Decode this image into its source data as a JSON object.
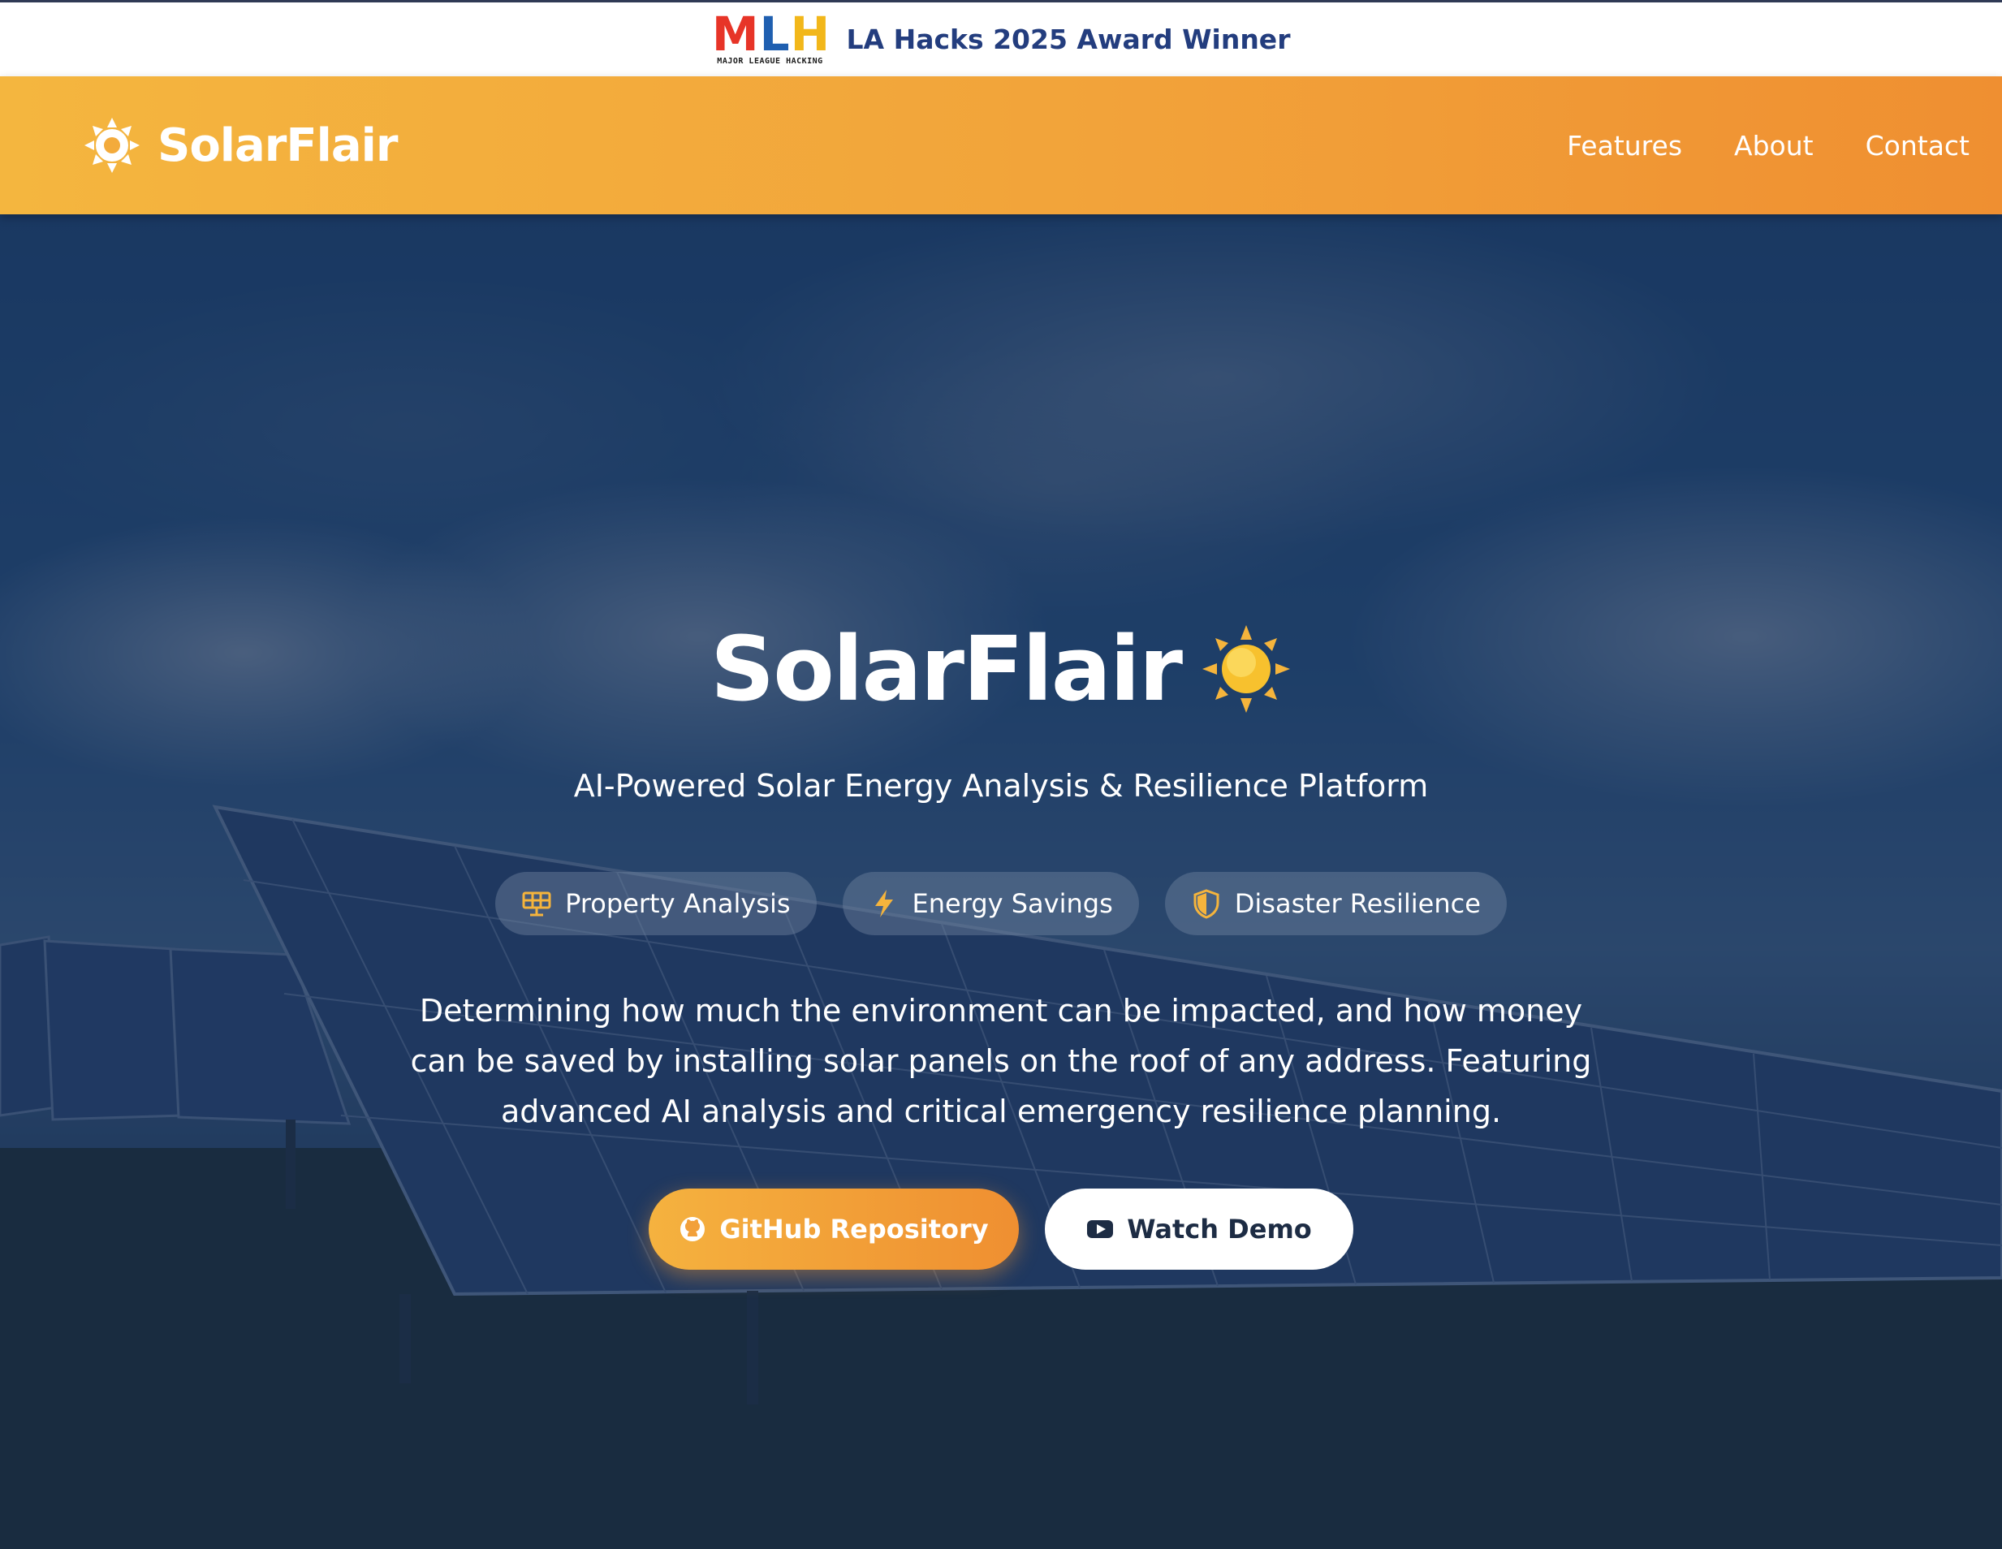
{
  "award_banner": {
    "logo_letters": [
      "M",
      "L",
      "H"
    ],
    "logo_subtext": "MAJOR LEAGUE HACKING",
    "text": "LA Hacks 2025 Award Winner"
  },
  "nav": {
    "brand": "SolarFlair",
    "links": [
      "Features",
      "About",
      "Contact"
    ]
  },
  "hero": {
    "title": "SolarFlair",
    "title_emoji": "sun-icon",
    "subtitle": "AI-Powered Solar Energy Analysis & Resilience Platform",
    "features": [
      {
        "icon": "solar-panel-icon",
        "label": "Property Analysis"
      },
      {
        "icon": "bolt-icon",
        "label": "Energy Savings"
      },
      {
        "icon": "shield-icon",
        "label": "Disaster Resilience"
      }
    ],
    "description": "Determining how much the environment can be impacted, and how money can be saved by installing solar panels on the roof of any address. Featuring advanced AI analysis and critical emergency resilience planning.",
    "buttons": {
      "primary": {
        "icon": "github-icon",
        "label": "GitHub Repository"
      },
      "secondary": {
        "icon": "youtube-icon",
        "label": "Watch Demo"
      }
    }
  },
  "colors": {
    "accent_start": "#f4b63f",
    "accent_end": "#ef8f31",
    "icon_accent": "#f5b43c",
    "mlh_red": "#e73427",
    "mlh_blue": "#1f5fb0",
    "mlh_yellow": "#f2b71a",
    "award_text": "#233d7e",
    "overlay": "#10284e"
  }
}
